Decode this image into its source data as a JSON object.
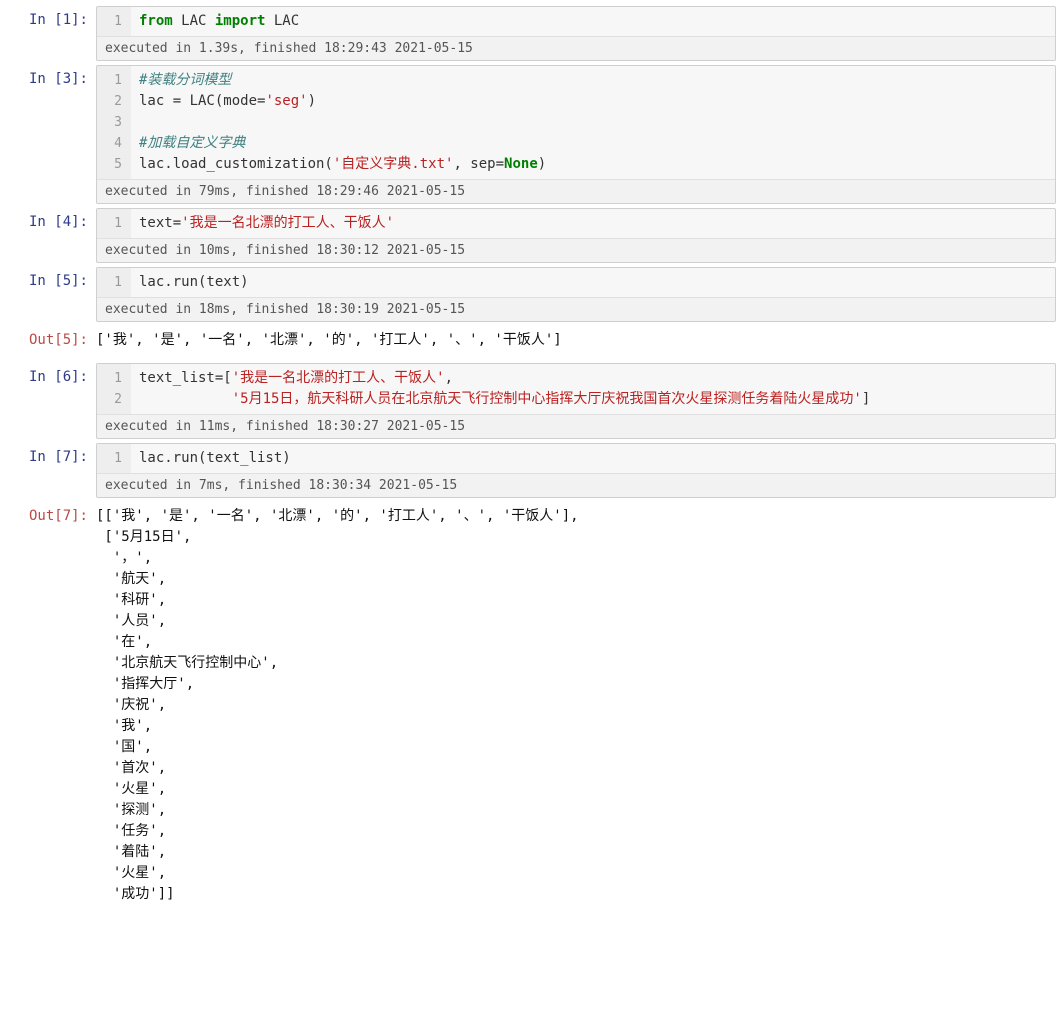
{
  "cells": [
    {
      "in_prompt": "In [1]:",
      "gutter": [
        "1"
      ],
      "code_html": "<span class='kw'>from</span> LAC <span class='kw'>import</span> LAC",
      "footer": "executed in 1.39s, finished 18:29:43 2021-05-15"
    },
    {
      "in_prompt": "In [3]:",
      "gutter": [
        "1",
        "2",
        "3",
        "4",
        "5"
      ],
      "code_html": "<span class='cm'>#装载分词模型</span>\nlac = LAC(mode=<span class='st'>'seg'</span>)\n\n<span class='cm'>#加载自定义字典</span>\nlac.load_customization(<span class='st'>'自定义字典.txt'</span>, sep=<span class='bi'>None</span>)",
      "footer": "executed in 79ms, finished 18:29:46 2021-05-15"
    },
    {
      "in_prompt": "In [4]:",
      "gutter": [
        "1"
      ],
      "code_html": "text=<span class='st'>'我是一名北漂的打工人、干饭人'</span>",
      "footer": "executed in 10ms, finished 18:30:12 2021-05-15"
    },
    {
      "in_prompt": "In [5]:",
      "gutter": [
        "1"
      ],
      "code_html": "lac.run(text)",
      "footer": "executed in 18ms, finished 18:30:19 2021-05-15",
      "out_prompt": "Out[5]:",
      "output": "['我', '是', '一名', '北漂', '的', '打工人', '、', '干饭人']"
    },
    {
      "in_prompt": "In [6]:",
      "gutter": [
        "1",
        "2"
      ],
      "code_html": "text_list=[<span class='st'>'我是一名北漂的打工人、干饭人'</span>,\n           <span class='st'>'5月15日，航天科研人员在北京航天飞行控制中心指挥大厅庆祝我国首次火星探测任务着陆火星成功'</span>]",
      "footer": "executed in 11ms, finished 18:30:27 2021-05-15"
    },
    {
      "in_prompt": "In [7]:",
      "gutter": [
        "1"
      ],
      "code_html": "lac.run(text_list)",
      "footer": "executed in 7ms, finished 18:30:34 2021-05-15",
      "out_prompt": "Out[7]:",
      "output": "[['我', '是', '一名', '北漂', '的', '打工人', '、', '干饭人'],\n ['5月15日',\n  '，',\n  '航天',\n  '科研',\n  '人员',\n  '在',\n  '北京航天飞行控制中心',\n  '指挥大厅',\n  '庆祝',\n  '我',\n  '国',\n  '首次',\n  '火星',\n  '探测',\n  '任务',\n  '着陆',\n  '火星',\n  '成功']]"
    }
  ]
}
